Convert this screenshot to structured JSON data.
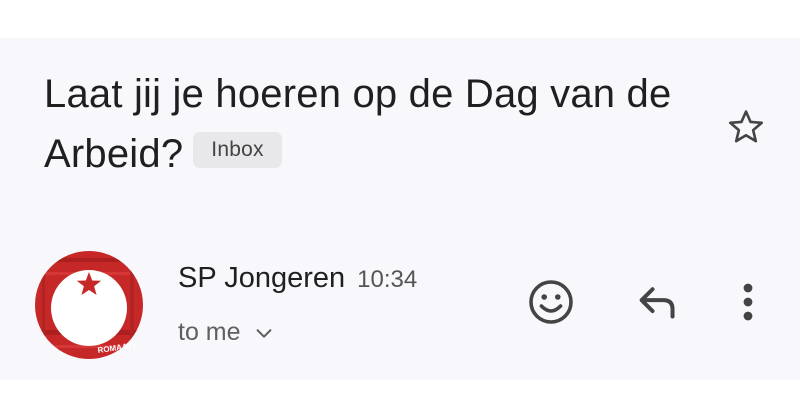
{
  "email": {
    "subject": "Laat jij je hoeren op de Dag van de Arbeid?",
    "label": "Inbox",
    "sender": "SP Jongeren",
    "time": "10:34",
    "recipient": "to me"
  },
  "avatar": {
    "logo_text": "ROMAATT"
  },
  "icons": {
    "star": "star-outline-icon",
    "emoji": "smiley-icon",
    "reply": "reply-arrow-icon",
    "more": "vertical-dots-icon",
    "expand": "chevron-down-icon"
  },
  "colors": {
    "background": "#f8f7fb",
    "text": "#1f1f1f",
    "secondary_text": "#5f5f5f",
    "badge_bg": "#e8e8ea",
    "logo_red": "#c62828"
  }
}
